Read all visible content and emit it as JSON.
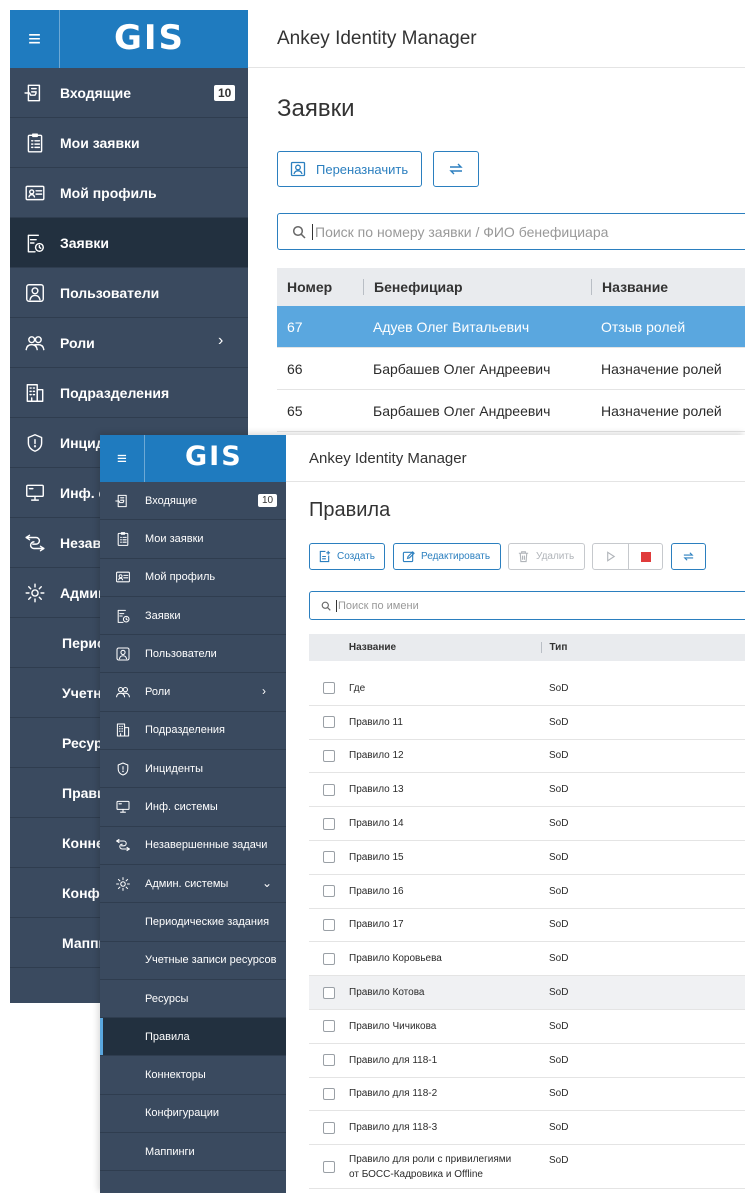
{
  "back_window": {
    "logo": "GIS",
    "menu_icon": "hamburger-icon",
    "app_title": "Ankey Identity Manager",
    "page_title": "Заявки",
    "nav": [
      {
        "label": "Входящие",
        "icon": "inbox-icon",
        "badge": "10"
      },
      {
        "label": "Мои заявки",
        "icon": "clipboard-list-icon"
      },
      {
        "label": "Мой профиль",
        "icon": "id-card-icon"
      },
      {
        "label": "Заявки",
        "icon": "request-clock-icon",
        "active": true
      },
      {
        "label": "Пользователи",
        "icon": "user-icon"
      },
      {
        "label": "Роли",
        "icon": "users-icon",
        "chevron": "›"
      },
      {
        "label": "Подразделения",
        "icon": "building-icon"
      },
      {
        "label": "Инциденты",
        "icon": "shield-icon"
      },
      {
        "label": "Инф. системы",
        "icon": "monitor-icon"
      },
      {
        "label": "Незавершенные задачи",
        "icon": "task-icon"
      },
      {
        "label": "Админ. системы",
        "icon": "gear-icon"
      },
      {
        "label": "Периодические задания"
      },
      {
        "label": "Учетные записи ресурсов"
      },
      {
        "label": "Ресурсы"
      },
      {
        "label": "Правила"
      },
      {
        "label": "Коннекторы"
      },
      {
        "label": "Конфигурации"
      },
      {
        "label": "Маппинги"
      }
    ],
    "toolbar": {
      "reassign_label": "Переназначить"
    },
    "search": {
      "placeholder": "Поиск по номеру заявки / ФИО бенефициара",
      "value": ""
    },
    "table": {
      "headers": [
        "Номер",
        "Бенефициар",
        "Название"
      ],
      "rows": [
        {
          "number": "67",
          "beneficiary": "Адуев Олег Витальевич",
          "name": "Отзыв ролей",
          "selected": true
        },
        {
          "number": "66",
          "beneficiary": "Барбашев Олег Андреевич",
          "name": "Назначение ролей"
        },
        {
          "number": "65",
          "beneficiary": "Барбашев Олег Андреевич",
          "name": "Назначение ролей"
        }
      ]
    }
  },
  "front_window": {
    "logo": "GIS",
    "app_title": "Ankey Identity Manager",
    "page_title": "Правила",
    "nav": [
      {
        "label": "Входящие",
        "icon": "inbox-icon",
        "badge": "10"
      },
      {
        "label": "Мои заявки",
        "icon": "clipboard-list-icon"
      },
      {
        "label": "Мой профиль",
        "icon": "id-card-icon"
      },
      {
        "label": "Заявки",
        "icon": "request-clock-icon"
      },
      {
        "label": "Пользователи",
        "icon": "user-icon"
      },
      {
        "label": "Роли",
        "icon": "users-icon",
        "chevron": "›"
      },
      {
        "label": "Подразделения",
        "icon": "building-icon"
      },
      {
        "label": "Инциденты",
        "icon": "shield-icon"
      },
      {
        "label": "Инф. системы",
        "icon": "monitor-icon"
      },
      {
        "label": "Незавершенные задачи",
        "icon": "task-icon"
      },
      {
        "label": "Админ. системы",
        "icon": "gear-icon",
        "chevron": "⌄"
      },
      {
        "label": "Периодические задания"
      },
      {
        "label": "Учетные записи ресурсов"
      },
      {
        "label": "Ресурсы"
      },
      {
        "label": "Правила",
        "active": true
      },
      {
        "label": "Коннекторы"
      },
      {
        "label": "Конфигурации"
      },
      {
        "label": "Маппинги"
      }
    ],
    "toolbar": {
      "create_label": "Создать",
      "edit_label": "Редактировать",
      "delete_label": "Удалить"
    },
    "search": {
      "placeholder": "Поиск по имени",
      "value": ""
    },
    "table": {
      "headers": [
        "Название",
        "Тип"
      ],
      "rows": [
        {
          "name": "Где",
          "type": "SoD"
        },
        {
          "name": "Правило 11",
          "type": "SoD"
        },
        {
          "name": "Правило 12",
          "type": "SoD"
        },
        {
          "name": "Правило 13",
          "type": "SoD"
        },
        {
          "name": "Правило 14",
          "type": "SoD"
        },
        {
          "name": "Правило 15",
          "type": "SoD"
        },
        {
          "name": "Правило 16",
          "type": "SoD"
        },
        {
          "name": "Правило 17",
          "type": "SoD"
        },
        {
          "name": "Правило Коровьева",
          "type": "SoD"
        },
        {
          "name": "Правило Котова",
          "type": "SoD",
          "hover": true
        },
        {
          "name": "Правило Чичикова",
          "type": "SoD"
        },
        {
          "name": "Правило для 118-1",
          "type": "SoD"
        },
        {
          "name": "Правило для 118-2",
          "type": "SoD"
        },
        {
          "name": "Правило для 118-3",
          "type": "SoD"
        },
        {
          "name": "Правило для роли с привилегиями от БОСС-Кадровика и Offline",
          "type": "SoD",
          "tall": true
        }
      ]
    }
  },
  "colors": {
    "sidebar": "#3a4a5f",
    "sidebar_active": "#22303f",
    "brand": "#1f7bbf",
    "accent": "#2b7fbf",
    "selected_row": "#5aa7df",
    "stop": "#e03b3b"
  }
}
